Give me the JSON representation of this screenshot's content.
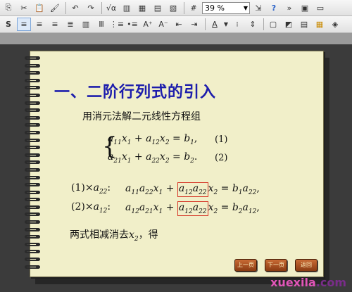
{
  "toolbar_top": {
    "zoom": "39 %"
  },
  "slide": {
    "title": "一、二阶行列式的引入",
    "subtitle": "用消元法解二元线性方程组",
    "eq1": {
      "a": "a",
      "s1": "11",
      "x": "x",
      "x1": "1",
      "a2": "a",
      "s2": "12",
      "x2": "x",
      "xs2": "2",
      "b": "b",
      "bs": "1",
      "tail": ",",
      "num": "1"
    },
    "eq2": {
      "a": "a",
      "s1": "21",
      "x": "x",
      "x1": "1",
      "a2": "a",
      "s2": "22",
      "x2": "x",
      "xs2": "2",
      "b": "b",
      "bs": "2",
      "tail": ".",
      "num": "2"
    },
    "row3": {
      "prefix_num": "1",
      "mul": "a",
      "mul_s": "22",
      "lhs": "a",
      "lhs_s1": "11",
      "lhs_a2": "a",
      "lhs_s2": "22",
      "lhs_x": "x",
      "lhs_xs": "1",
      "box_a": "a",
      "box_s1": "12",
      "box_a2": "a",
      "box_s2": "22",
      "rx": "x",
      "rxs": "2",
      "rb": "b",
      "rbs": "1",
      "ra": "a",
      "ras": "22",
      "tail": ","
    },
    "row4": {
      "prefix_num": "2",
      "mul": "a",
      "mul_s": "12",
      "lhs": "a",
      "lhs_s1": "12",
      "lhs_a2": "a",
      "lhs_s2": "21",
      "lhs_x": "x",
      "lhs_xs": "1",
      "box_a": "a",
      "box_s1": "12",
      "box_a2": "a",
      "box_s2": "22",
      "rx": "x",
      "rxs": "2",
      "rb": "b",
      "rbs": "2",
      "ra": "a",
      "ras": "12",
      "tail": ","
    },
    "conclusion_prefix": "两式相减消去",
    "conclusion_var": "x",
    "conclusion_sub": "2",
    "conclusion_suffix": "，得",
    "nav": {
      "prev": "上一页",
      "next": "下一页",
      "back": "返回"
    }
  },
  "watermark": {
    "main": "xuexila",
    "tld": ".com"
  },
  "colors": {
    "title": "#1d1dac",
    "paper": "#f1efc9",
    "box": "#d63a2a"
  }
}
